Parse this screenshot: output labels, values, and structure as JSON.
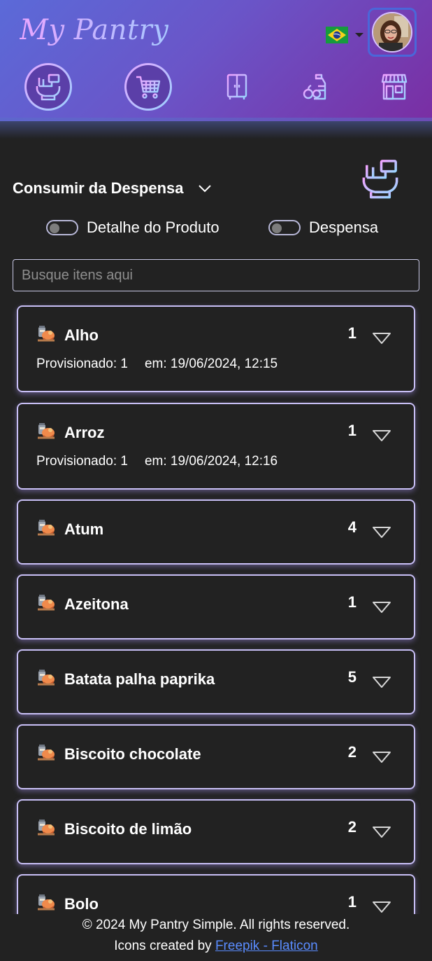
{
  "app": {
    "title": "My Pantry"
  },
  "header": {
    "brand": "My Pantry",
    "language": "pt-BR",
    "nav": [
      {
        "name": "consume",
        "active": true
      },
      {
        "name": "cart",
        "active": true
      },
      {
        "name": "wardrobe",
        "active": false
      },
      {
        "name": "groceries",
        "active": false
      },
      {
        "name": "store",
        "active": false
      }
    ]
  },
  "section": {
    "title": "Consumir da Despensa"
  },
  "toggles": {
    "product_detail": "Detalhe do Produto",
    "pantry": "Despensa"
  },
  "search": {
    "placeholder": "Busque itens aqui"
  },
  "items": [
    {
      "name": "Alho",
      "qty": "1",
      "provisioned": "Provisionado: 1",
      "date": "em: 19/06/2024, 12:15"
    },
    {
      "name": "Arroz",
      "qty": "1",
      "provisioned": "Provisionado: 1",
      "date": "em: 19/06/2024, 12:16"
    },
    {
      "name": "Atum",
      "qty": "4"
    },
    {
      "name": "Azeitona",
      "qty": "1"
    },
    {
      "name": "Batata palha paprika",
      "qty": "5"
    },
    {
      "name": "Biscoito chocolate",
      "qty": "2"
    },
    {
      "name": "Biscoito de limão",
      "qty": "2"
    },
    {
      "name": "Bolo",
      "qty": "1"
    }
  ],
  "footer": {
    "copyright": "© 2024 My Pantry Simple. All rights reserved.",
    "credits_prefix": "Icons created by",
    "credits_link": "Freepik - Flaticon"
  }
}
